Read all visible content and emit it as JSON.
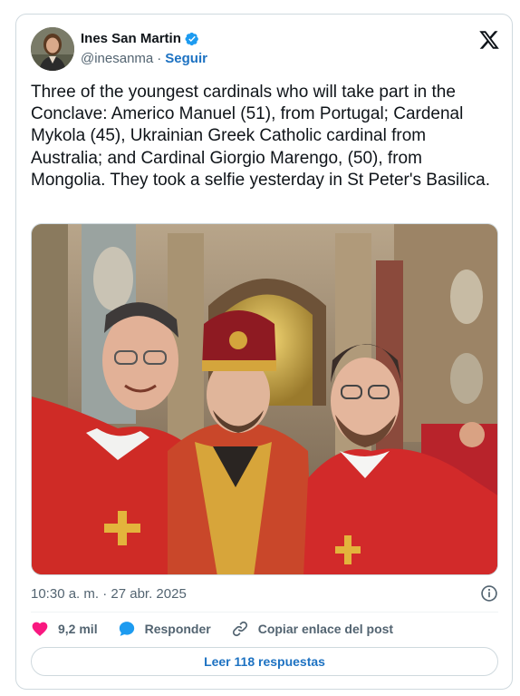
{
  "author": {
    "name": "Ines San Martin",
    "handle": "@inesanma",
    "separator": "·",
    "follow_label": "Seguir",
    "verified": true
  },
  "icons": {
    "verified": "verified-badge-icon",
    "platform": "x-logo-icon",
    "info": "info-icon",
    "like": "heart-icon",
    "reply": "speech-bubble-icon",
    "copy_link": "link-icon"
  },
  "tweet": {
    "text": "Three of the youngest cardinals who will take part in the Conclave: Americo Manuel (51), from Portugal; Cardenal Mykola (45), Ukrainian Greek Catholic cardinal from Australia; and Cardinal Giorgio Marengo, (50), from Mongolia. They took a selfie yesterday in St Peter's Basilica.",
    "timestamp": "10:30 a. m. · 27 abr. 2025"
  },
  "actions": {
    "likes_count": "9,2 mil",
    "reply_label": "Responder",
    "copy_link_label": "Copiar enlace del post"
  },
  "replies_button": "Leer 118 respuestas",
  "colors": {
    "accent": "#1d72c2",
    "like": "#f91880",
    "reply": "#1d9bf0",
    "text_secondary": "#536471",
    "border": "#cfd9de"
  }
}
